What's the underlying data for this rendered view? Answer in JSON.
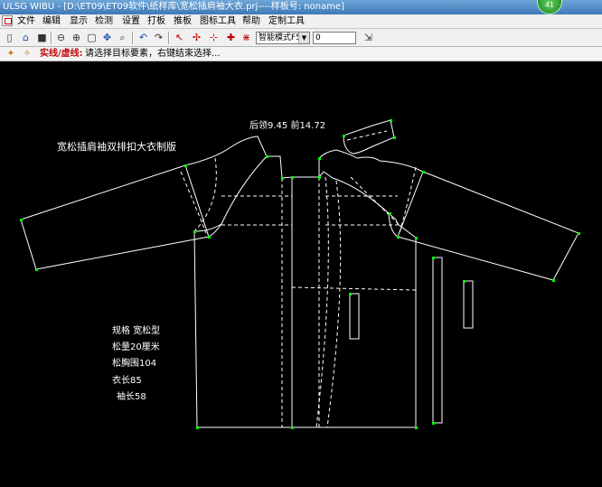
{
  "window": {
    "title": "ULSG WIBU - [D:\\ET09\\ET09软件\\纸样库\\宽松插肩袖大衣.prj----样板号: noname]",
    "badge": "41"
  },
  "menu": {
    "items": [
      "文件",
      "编辑",
      "显示",
      "检测",
      "设置",
      "打板",
      "推板",
      "图标工具",
      "帮助",
      "定制工具"
    ]
  },
  "toolbar": {
    "mode_select": "智能模式F5",
    "value_input": "0",
    "icons": [
      "new-file-icon",
      "open-folder-icon",
      "save-icon",
      "zoom-out-icon",
      "zoom-in-icon",
      "fit-window-icon",
      "pan-icon",
      "zoom-area-icon",
      "undo-icon",
      "redo-icon",
      "select-delete-icon",
      "add-point-icon",
      "cut-point-icon",
      "cross-point-icon",
      "measure-icon",
      "snap-icon"
    ]
  },
  "status": {
    "label": "实线/虚线:",
    "hint": "请选择目标要素，右键结束选择..."
  },
  "canvas": {
    "colors": {
      "line": "#ffffff",
      "point": "#00ff00",
      "background": "#000000"
    },
    "measure_text": "后领9.45    前14.72",
    "pattern_title": "宽松插肩袖双排扣大衣制版",
    "specs": [
      "规格   宽松型",
      "松量20厘米",
      "松胸围104",
      "衣长85",
      "袖长58"
    ]
  }
}
